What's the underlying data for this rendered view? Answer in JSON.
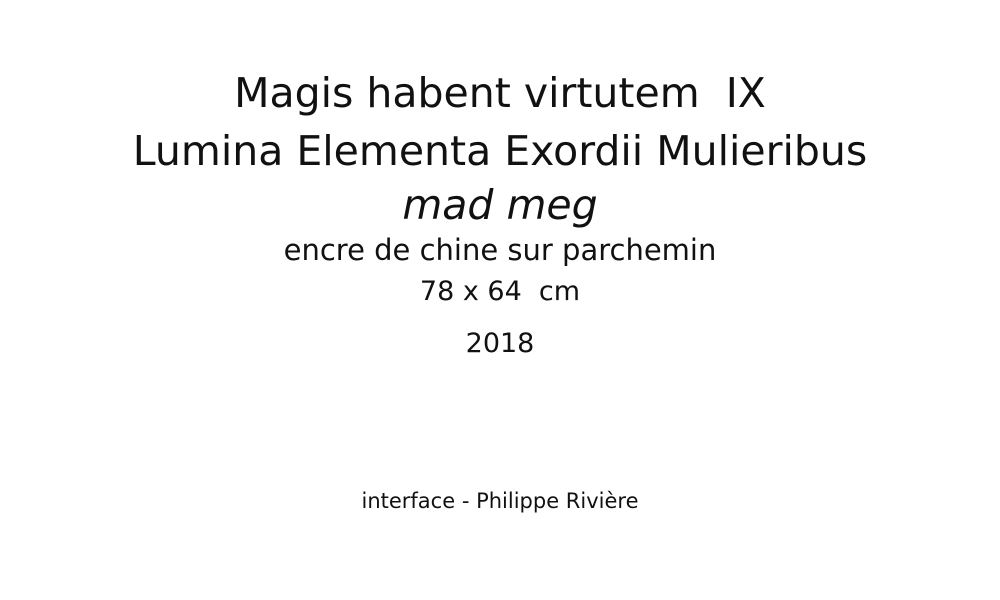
{
  "artwork": {
    "title_line_1": "Magis habent virtutem  IX",
    "title_line_2": "Lumina Elementa Exordii Mulieribus",
    "artist": "mad meg",
    "medium": "encre de chine sur parchemin",
    "dimensions": "78 x 64  cm",
    "year": "2018"
  },
  "credit": {
    "text": "interface - Philippe Rivière"
  }
}
